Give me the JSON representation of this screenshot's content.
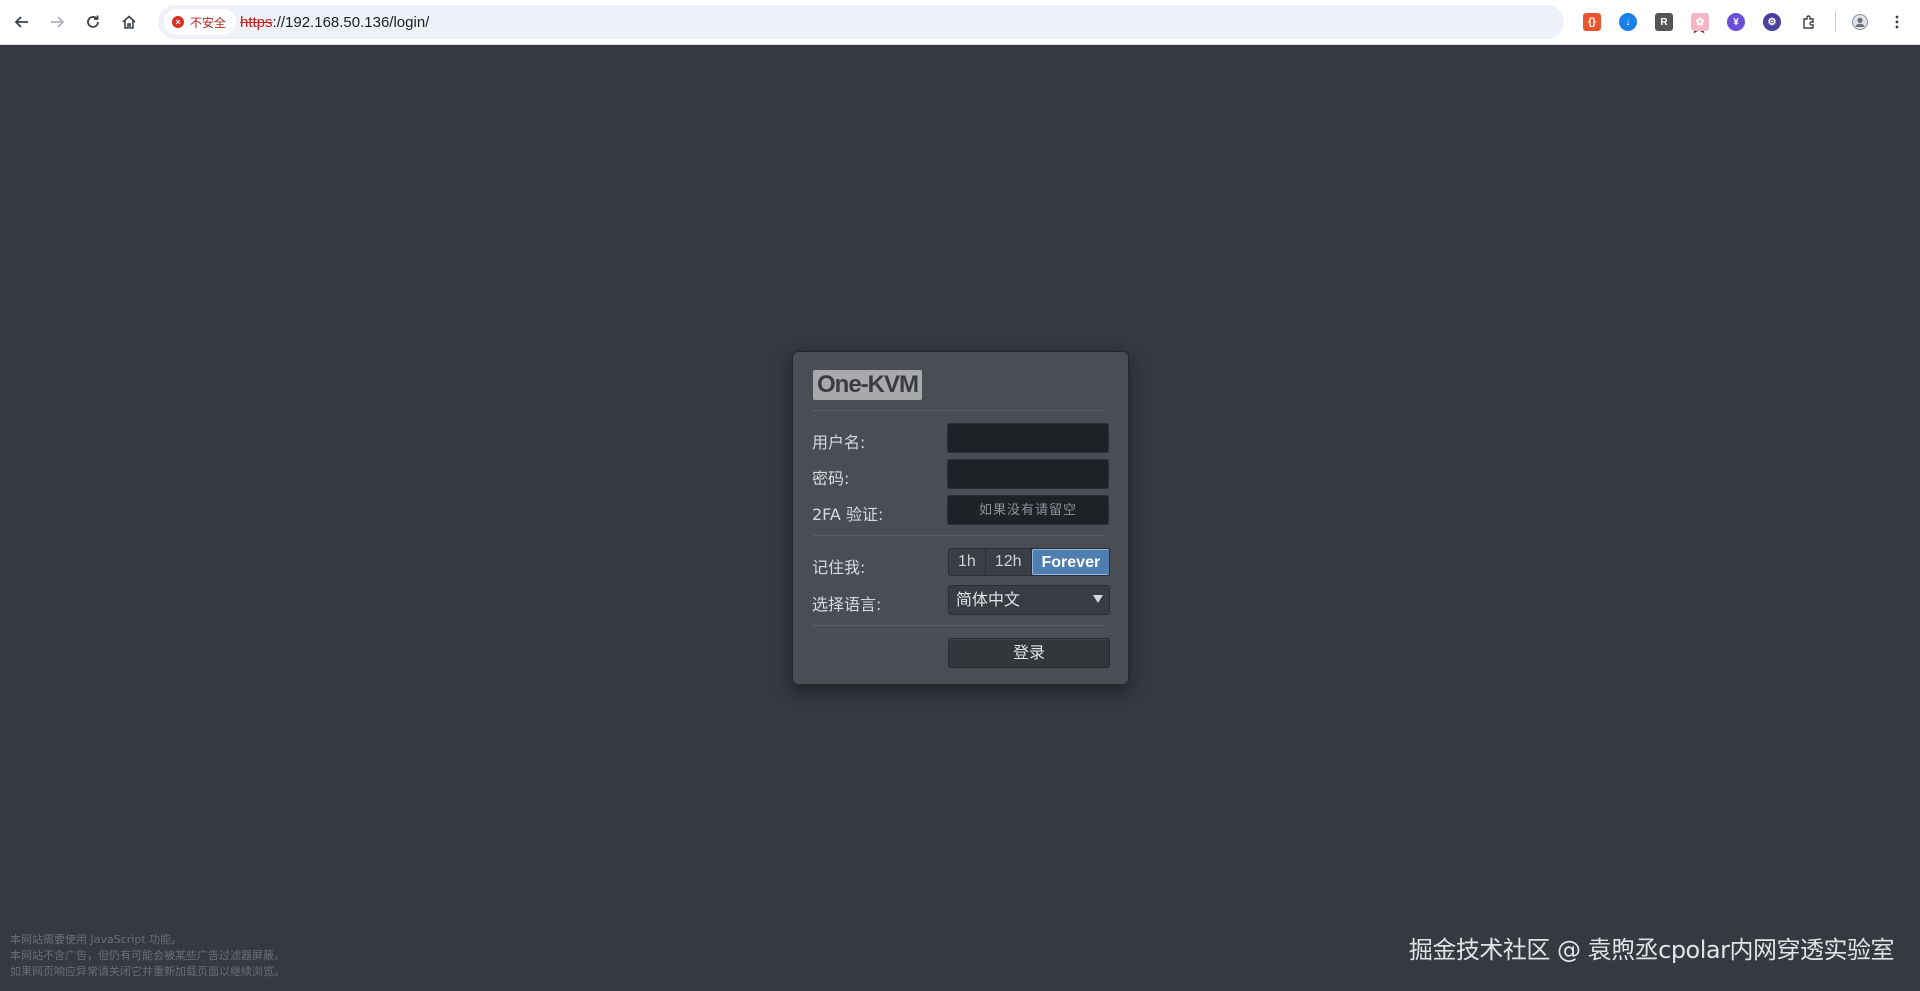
{
  "browser": {
    "security_label": "不安全",
    "url_scheme": "https",
    "url_rest": "://192.168.50.136/login/",
    "extensions": [
      {
        "name": "code-ext-icon",
        "color": "#e8562f",
        "glyph": "{}"
      },
      {
        "name": "download-ext-icon",
        "color": "#1a7fe8",
        "glyph": "↓"
      },
      {
        "name": "r-ext-icon",
        "color": "#555555",
        "glyph": "R"
      },
      {
        "name": "bunny-ext-icon",
        "color": "#f3b7c6",
        "glyph": "✿"
      },
      {
        "name": "purple-ext-icon",
        "color": "#6a4fd8",
        "glyph": "¥"
      },
      {
        "name": "gear-ext-icon",
        "color": "#4b3f9e",
        "glyph": "⚙"
      }
    ]
  },
  "login": {
    "logo": "One-KVM",
    "username_label": "用户名:",
    "password_label": "密码:",
    "twofa_label": "2FA 验证:",
    "twofa_placeholder": "如果没有请留空",
    "remember_label": "记住我:",
    "remember_options": [
      "1h",
      "12h",
      "Forever"
    ],
    "remember_selected": "Forever",
    "language_label": "选择语言:",
    "language_value": "简体中文",
    "login_button": "登录"
  },
  "footer": {
    "notice_lines": [
      "本网站需要使用 JavaScript 功能。",
      "本网站不含广告，但仍有可能会被某些广告过滤器屏蔽。",
      "如果网页响应异常请关闭它并重新加载页面以继续浏览。"
    ],
    "watermark": "掘金技术社区 @ 袁煦丞cpolar内网穿透实验室"
  }
}
